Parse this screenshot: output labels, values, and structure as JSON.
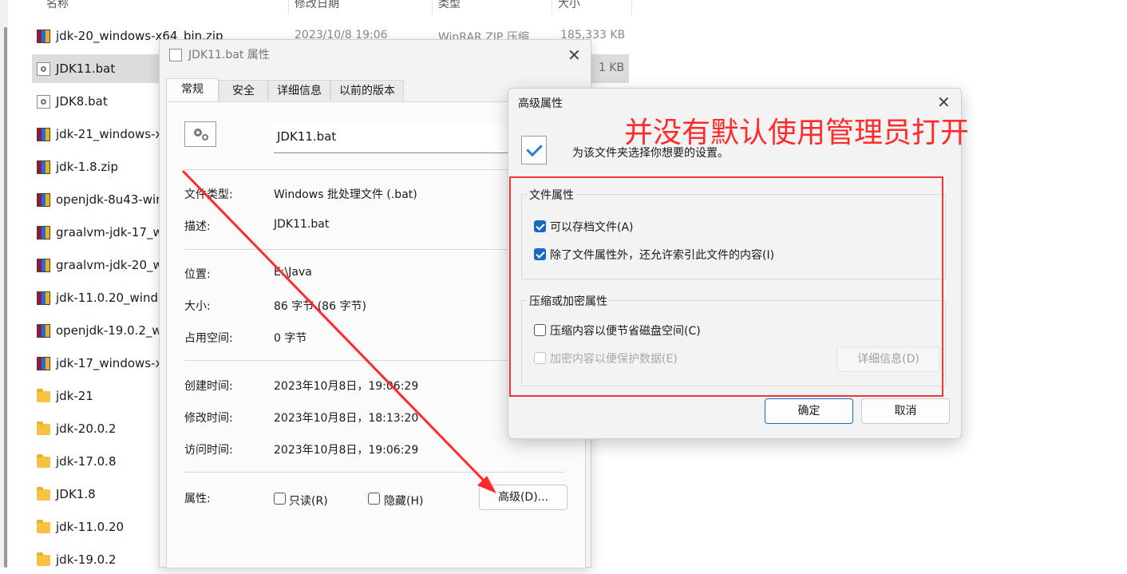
{
  "explorer": {
    "columns": [
      "名称",
      "修改日期",
      "类型",
      "大小"
    ],
    "selected_row": {
      "name": "JDK11.bat",
      "size": "1 KB"
    },
    "first_row": {
      "name": "jdk-20_windows-x64_bin.zip",
      "date": "2023/10/8 19:06",
      "type": "WinRAR ZIP 压缩...",
      "size": "185,333 KB"
    },
    "rows": [
      {
        "name": "jdk-20_windows-x64_bin.zip",
        "icon": "zip-icon"
      },
      {
        "name": "JDK11.bat",
        "icon": "bat-icon"
      },
      {
        "name": "JDK8.bat",
        "icon": "bat-icon"
      },
      {
        "name": "jdk-21_windows-x",
        "icon": "zip-icon"
      },
      {
        "name": "jdk-1.8.zip",
        "icon": "zip-icon"
      },
      {
        "name": "openjdk-8u43-wir",
        "icon": "zip-icon"
      },
      {
        "name": "graalvm-jdk-17_w",
        "icon": "zip-icon"
      },
      {
        "name": "graalvm-jdk-20_w",
        "icon": "zip-icon"
      },
      {
        "name": "jdk-11.0.20_windo",
        "icon": "zip-icon"
      },
      {
        "name": "openjdk-19.0.2_w",
        "icon": "zip-icon"
      },
      {
        "name": "jdk-17_windows-x",
        "icon": "zip-icon"
      },
      {
        "name": "jdk-21",
        "icon": "folder-icon"
      },
      {
        "name": "jdk-20.0.2",
        "icon": "folder-icon"
      },
      {
        "name": "jdk-17.0.8",
        "icon": "folder-icon"
      },
      {
        "name": "JDK1.8",
        "icon": "folder-icon"
      },
      {
        "name": "jdk-11.0.20",
        "icon": "folder-icon"
      },
      {
        "name": "jdk-19.0.2",
        "icon": "folder-icon"
      }
    ]
  },
  "props": {
    "title": "JDK11.bat 属性",
    "tabs": [
      "常规",
      "安全",
      "详细信息",
      "以前的版本"
    ],
    "filename": "JDK11.bat",
    "fields": [
      {
        "label": "文件类型:",
        "value": "Windows 批处理文件 (.bat)"
      },
      {
        "label": "描述:",
        "value": "JDK11.bat"
      },
      {
        "label": "位置:",
        "value": "E:\\Java"
      },
      {
        "label": "大小:",
        "value": "86 字节 (86 字节)"
      },
      {
        "label": "占用空间:",
        "value": "0 字节"
      },
      {
        "label": "创建时间:",
        "value": "2023年10月8日，19:06:29"
      },
      {
        "label": "修改时间:",
        "value": "2023年10月8日，18:13:20"
      },
      {
        "label": "访问时间:",
        "value": "2023年10月8日，19:06:29"
      }
    ],
    "attributes_label": "属性:",
    "readonly_label": "只读(R)",
    "hidden_label": "隐藏(H)",
    "advanced_button": "高级(D)..."
  },
  "advanced": {
    "title": "高级属性",
    "description": "为该文件夹选择你想要的设置。",
    "file_attr_group": "文件属性",
    "archive_label": "可以存档文件(A)",
    "index_label": "除了文件属性外，还允许索引此文件的内容(I)",
    "compress_group": "压缩或加密属性",
    "compress_label": "压缩内容以便节省磁盘空间(C)",
    "encrypt_label": "加密内容以便保护数据(E)",
    "details_button": "详细信息(D)",
    "ok_button": "确定",
    "cancel_button": "取消"
  },
  "annotation": {
    "text": "并没有默认使用管理员打开",
    "color": "#ff2b2b"
  }
}
